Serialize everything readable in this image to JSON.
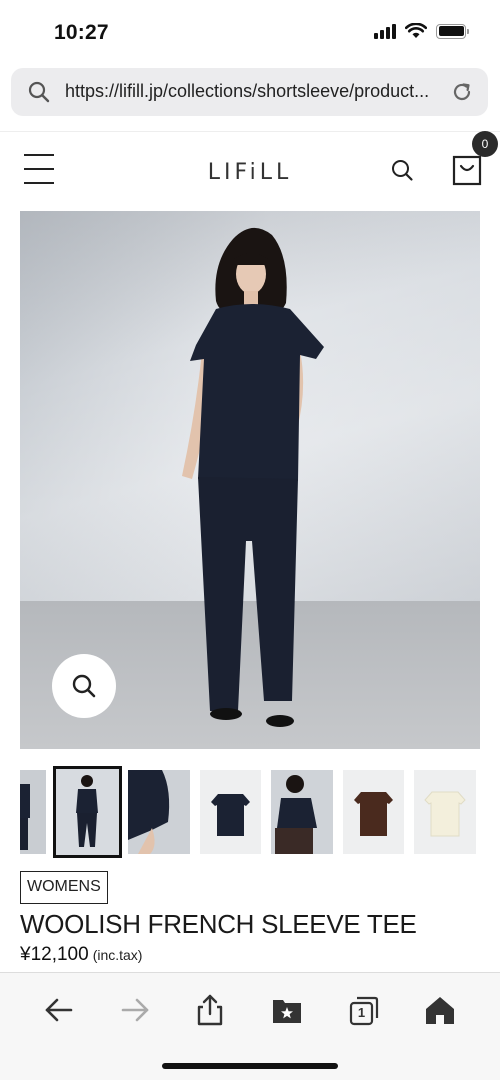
{
  "status": {
    "time": "10:27"
  },
  "browser": {
    "url": "https://lifill.jp/collections/shortsleeve/product..."
  },
  "header": {
    "logo": "LIFiLL",
    "cart_count": "0"
  },
  "product": {
    "category": "WOMENS",
    "title": "WOOLISH FRENCH SLEEVE TEE",
    "price": "¥12,100",
    "price_note": "(inc.tax)",
    "thumbnails": [
      "thumbnail-model-side",
      "thumbnail-model-front",
      "thumbnail-sleeve-detail",
      "thumbnail-navy-tee",
      "thumbnail-model-upper",
      "thumbnail-brown-tee",
      "thumbnail-cream-tee"
    ]
  },
  "icons": {
    "url_search": "search-icon",
    "reload": "reload-icon",
    "menu": "hamburger-menu-icon",
    "search": "search-icon",
    "cart": "shopping-bag-icon",
    "zoom": "zoom-icon",
    "back": "back-arrow-icon",
    "forward": "forward-arrow-icon",
    "share": "share-icon",
    "bookmarks": "bookmarks-icon",
    "tabs": "tabs-icon",
    "home": "home-icon"
  },
  "tabs_count": "1",
  "colors": {
    "garment_navy": "#1b2233",
    "accent_dark": "#2b2b2b",
    "brown_tee": "#4a2a1e",
    "cream_tee": "#f3efdc"
  }
}
